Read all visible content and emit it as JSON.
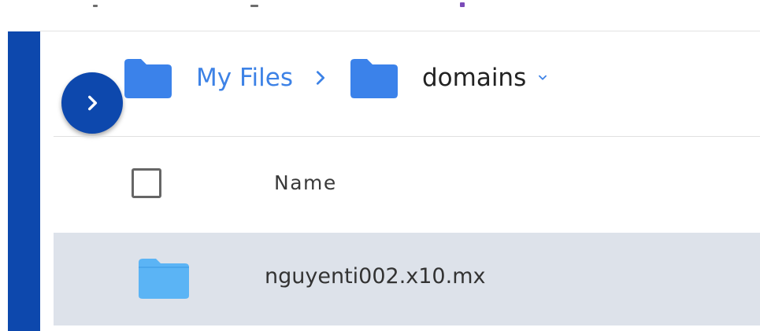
{
  "breadcrumb": {
    "root_label": "My Files",
    "current_label": "domains",
    "folder_icon": "folder-icon",
    "separator_icon": "chevron-right-icon",
    "caret_icon": "chevron-down-icon"
  },
  "sidebar_toggle": {
    "icon": "chevron-right-icon"
  },
  "table": {
    "columns": [
      "Name"
    ],
    "rows": [
      {
        "name": "nguyenti002.x10.mx",
        "icon": "folder-icon"
      }
    ]
  },
  "colors": {
    "sidebar": "#0d48ad",
    "link": "#3d82e6",
    "folder": "#3b82ea",
    "row_folder": "#5bb4f5",
    "row_highlight": "#dde2ea"
  }
}
